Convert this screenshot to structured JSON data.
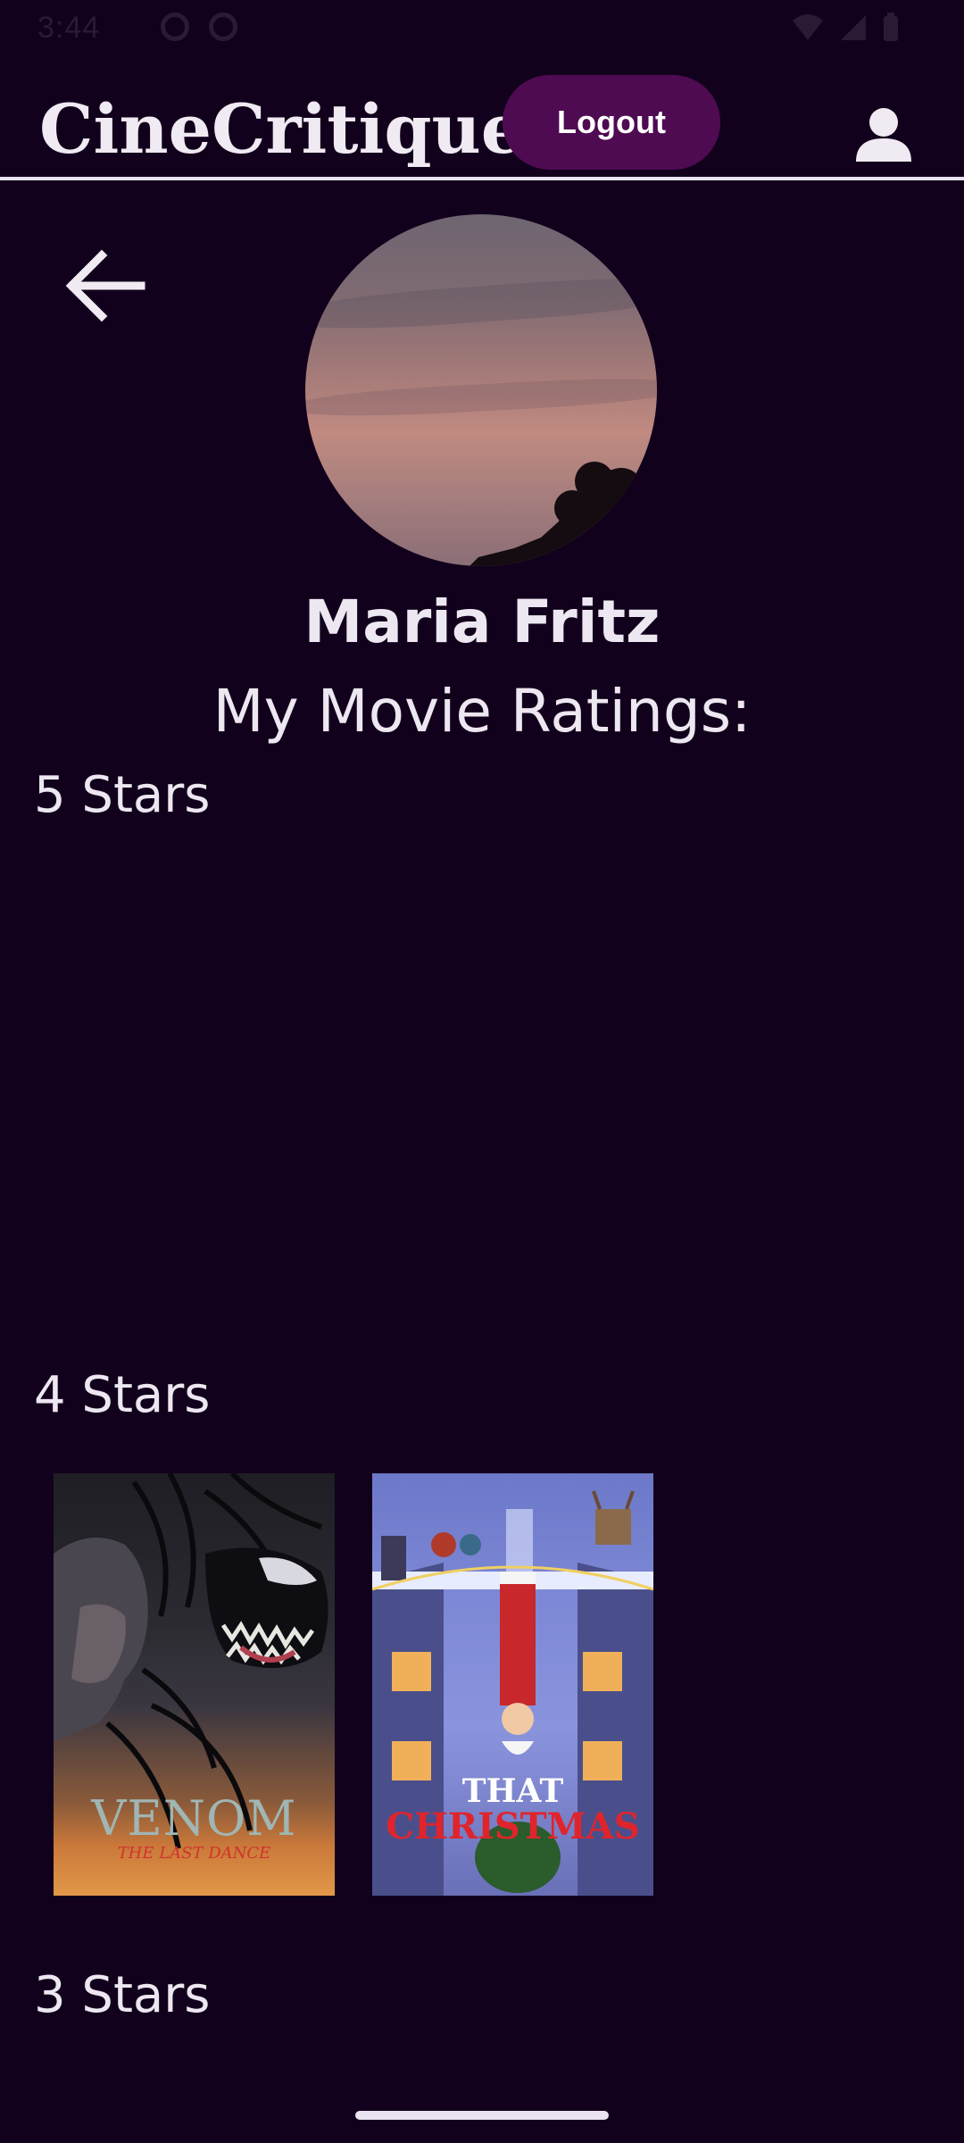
{
  "status_bar": {
    "time": "3:44"
  },
  "header": {
    "app_title": "CineCritique",
    "logout_label": "Logout"
  },
  "profile": {
    "name": "Maria Fritz",
    "ratings_heading": "My Movie Ratings:"
  },
  "sections": [
    {
      "label": "5 Stars",
      "movies": []
    },
    {
      "label": "4 Stars",
      "movies": [
        {
          "title": "VENOM",
          "subtitle": "THE LAST DANCE"
        },
        {
          "title_line1": "THAT",
          "title_line2": "CHRISTMAS"
        }
      ]
    },
    {
      "label": "3 Stars",
      "movies": []
    }
  ],
  "colors": {
    "background": "#12011c",
    "accent": "#4f0b52",
    "text": "#ece7f0"
  },
  "icons": {
    "profile": "person-icon",
    "back": "arrow-left-icon"
  }
}
